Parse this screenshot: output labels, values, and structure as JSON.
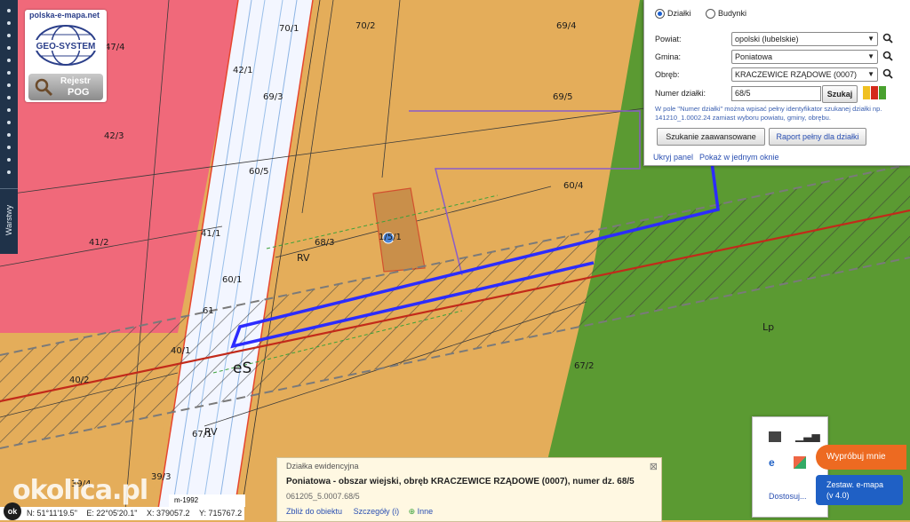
{
  "site": {
    "name": "polska-e-mapa.net",
    "logo": "GEO-SYSTEM",
    "badge_line1": "Rejestr",
    "badge_line2": "POG"
  },
  "toolbar": {
    "layers_tab": "Warstwy"
  },
  "map_labels": {
    "parcels": [
      "47/4",
      "42/1",
      "70/1",
      "70/2",
      "69/4",
      "69/3",
      "69/5",
      "42/3",
      "60/5",
      "41/1",
      "41/2",
      "68/3",
      "1/5/1",
      "60/4",
      "60/1",
      "61",
      "40/1",
      "40/2",
      "67/2",
      "67/1",
      "39/3",
      "39/4"
    ],
    "zones": [
      "RV",
      "RV",
      "Lp"
    ],
    "highlight_symbol": "eS"
  },
  "colors": {
    "agri": "#e4ad5a",
    "forest": "#5b9a32",
    "built": "#f0697a",
    "road": "#ffffff",
    "boundary": "#2c2cff",
    "power": "#c22a1a"
  },
  "search": {
    "mode_parcels": "Działki",
    "mode_buildings": "Budynki",
    "powiat_label": "Powiat:",
    "powiat_value": "opolski (lubelskie)",
    "gmina_label": "Gmina:",
    "gmina_value": "Poniatowa",
    "obreb_label": "Obręb:",
    "obreb_value": "KRACZEWICE RZĄDOWE (0007)",
    "nr_label": "Numer działki:",
    "nr_value": "68/5",
    "search_btn": "Szukaj",
    "note": "W pole \"Numer działki\" można wpisać pełny identyfikator szukanej działki np. 141210_1.0002.24 zamiast wyboru powiatu, gminy, obrębu.",
    "advanced_btn": "Szukanie zaawansowane",
    "report_btn": "Raport pełny dla działki",
    "link_hide": "Ukryj panel",
    "link_new_window": "Pokaż w jednym oknie"
  },
  "info_card": {
    "title": "Działka ewidencyjna",
    "name": "Poniatowa - obszar wiejski, obręb KRACZEWICE RZĄDOWE (0007), numer dz. 68/5",
    "id": "061205_5.0007.68/5",
    "link_zoom": "Zbliż do obiektu",
    "link_details": "Szczegóły (i)",
    "link_other": "Inne"
  },
  "layers_popup": {
    "more": "Dostosuj..."
  },
  "promo": {
    "try_label": "Wypróbuj mnie",
    "blue_line1": "Zestaw. e-mapa",
    "blue_line2": "(v 4.0)"
  },
  "coords": {
    "lat": "N: 51°11'19.5\"",
    "lon": "E: 22°05'20.1\"",
    "x": "X: 379057.2",
    "y": "Y: 715767.2"
  },
  "scale": "m-1992",
  "watermark": "okolica.pl",
  "ok_label": "ok"
}
